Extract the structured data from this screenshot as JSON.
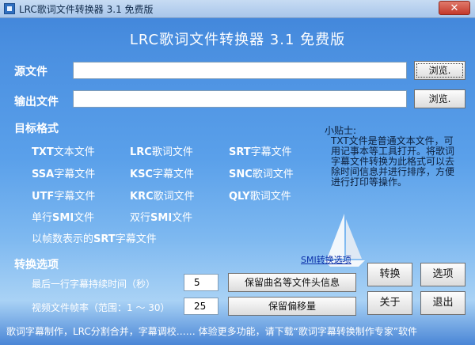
{
  "window": {
    "title": "LRC歌词文件转换器 3.1 免费版",
    "close_glyph": "✕"
  },
  "header": {
    "title": "LRC歌词文件转换器 3.1 免费版"
  },
  "source": {
    "label": "源文件",
    "value": "",
    "browse_label": "浏览."
  },
  "output": {
    "label": "输出文件",
    "value": "",
    "browse_label": "浏览."
  },
  "target_format": {
    "label": "目标格式",
    "items": [
      {
        "code": "TXT",
        "suffix": "文本文件"
      },
      {
        "code": "LRC",
        "suffix": "歌词文件"
      },
      {
        "code": "SRT",
        "suffix": "字幕文件"
      },
      {
        "code": "SSA",
        "suffix": "字幕文件"
      },
      {
        "code": "KSC",
        "suffix": "字幕文件"
      },
      {
        "code": "SNC",
        "suffix": "歌词文件"
      },
      {
        "code": "UTF",
        "suffix": "字幕文件"
      },
      {
        "code": "KRC",
        "suffix": "歌词文件"
      },
      {
        "code": "QLY",
        "suffix": "歌词文件"
      },
      {
        "prefix": "单行",
        "code": "SMI",
        "suffix": "文件"
      },
      {
        "prefix": "双行",
        "code": "SMI",
        "suffix": "文件"
      },
      {
        "prefix": "以帧数表示的",
        "code": "SRT",
        "suffix": "字幕文件"
      }
    ]
  },
  "tips": {
    "title": "小贴士:",
    "text": "TXT文件是普通文本文件，可用记事本等工具打开。将歌词字幕文件转换为此格式可以去除时间信息并进行排序，方便进行打印等操作。"
  },
  "convert_options": {
    "label": "转换选项",
    "smi_link": "SMI转换选项",
    "last_line_label": "最后一行字幕持续时间（秒）",
    "last_line_value": "5",
    "keep_header_label": "保留曲名等文件头信息",
    "fps_label": "视频文件帧率（范围：1 ～ 30）",
    "fps_value": "25",
    "keep_offset_label": "保留偏移量"
  },
  "actions": {
    "convert": "转换",
    "options": "选项",
    "about": "关于",
    "exit": "退出"
  },
  "footer": {
    "text": "歌词字幕制作，LRC分割合并，字幕调校…… 体验更多功能，请下载“歌词字幕转换制作专家”软件"
  },
  "colors": {
    "background_top": "#3f83d8",
    "background_bottom": "#a9d2f5",
    "link": "#0a2ea8"
  }
}
